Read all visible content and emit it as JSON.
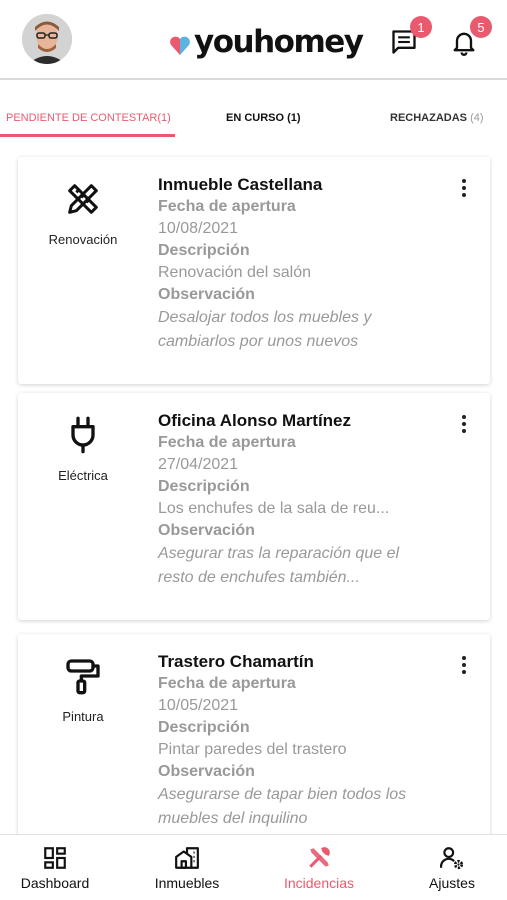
{
  "header": {
    "brand": "youhomey",
    "messages_badge": "1",
    "notifications_badge": "5"
  },
  "tabs": [
    {
      "label": "PENDIENTE DE CONTESTAR(1)",
      "active": true
    },
    {
      "label": "EN CURSO (1)",
      "active": false
    },
    {
      "label": "RECHAZADAS",
      "count": "(4)",
      "active": false
    }
  ],
  "cards": [
    {
      "icon": "pencil-ruler-icon",
      "category": "Renovación",
      "title": "Inmueble Castellana",
      "date_label": "Fecha de apertura",
      "date": "10/08/2021",
      "desc_label": "Descripción",
      "desc": "Renovación del salón",
      "obs_label": "Observación",
      "obs": "Desalojar todos los muebles y cambiarlos por unos nuevos"
    },
    {
      "icon": "plug-icon",
      "category": "Eléctrica",
      "title": "Oficina Alonso Martínez",
      "date_label": "Fecha de apertura",
      "date": "27/04/2021",
      "desc_label": "Descripción",
      "desc": "Los enchufes de la sala de reu...",
      "obs_label": "Observación",
      "obs": "Asegurar tras la reparación que  el resto de enchufes también..."
    },
    {
      "icon": "paint-roller-icon",
      "category": "Pintura",
      "title": "Trastero Chamartín",
      "date_label": "Fecha de apertura",
      "date": "10/05/2021",
      "desc_label": "Descripción",
      "desc": "Pintar paredes del trastero",
      "obs_label": "Observación",
      "obs": "Asegurarse de tapar bien todos los muebles del inquilino"
    }
  ],
  "bottom_nav": [
    {
      "label": "Dashboard",
      "icon": "dashboard-icon",
      "active": false
    },
    {
      "label": "Inmuebles",
      "icon": "building-icon",
      "active": false
    },
    {
      "label": "Incidencias",
      "icon": "tools-icon",
      "active": true
    },
    {
      "label": "Ajustes",
      "icon": "user-settings-icon",
      "active": false
    }
  ],
  "colors": {
    "accent": "#ea5a6f",
    "muted_text": "#999999"
  }
}
